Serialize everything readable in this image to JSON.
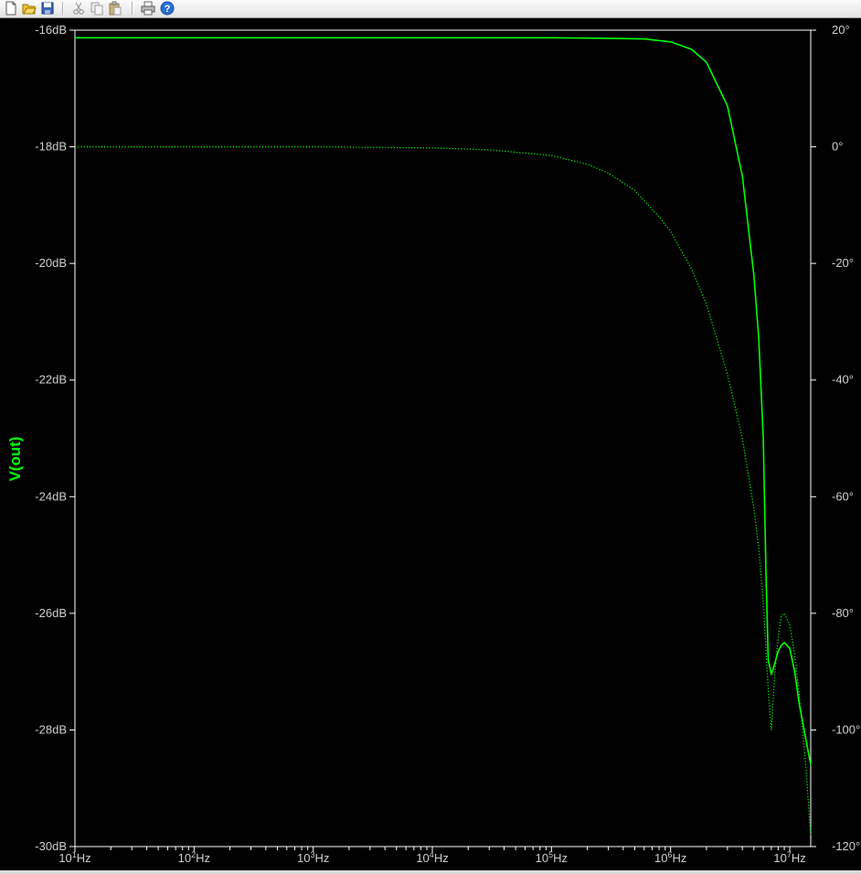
{
  "toolbar": {
    "buttons": [
      {
        "name": "new-icon"
      },
      {
        "name": "open-folder-icon"
      },
      {
        "name": "save-icon"
      },
      {
        "name": "cut-icon"
      },
      {
        "name": "copy-icon"
      },
      {
        "name": "paste-icon"
      },
      {
        "name": "print-icon"
      },
      {
        "name": "help-icon"
      }
    ]
  },
  "colors": {
    "background": "#000000",
    "trace": "#00ff00",
    "axis": "#ffffff",
    "tick_text": "#d0d0d0",
    "grid": "#404040"
  },
  "chart_data": {
    "type": "line",
    "ylabel": "V(out)",
    "x_scale": "log",
    "xlim": [
      10,
      15000000
    ],
    "ylim": [
      -30,
      -16
    ],
    "y2lim": [
      -120,
      20
    ],
    "x_ticks": [
      {
        "value": 10,
        "base": "10",
        "exp": "1",
        "unit": "Hz"
      },
      {
        "value": 100,
        "base": "10",
        "exp": "2",
        "unit": "Hz"
      },
      {
        "value": 1000,
        "base": "10",
        "exp": "3",
        "unit": "Hz"
      },
      {
        "value": 10000,
        "base": "10",
        "exp": "4",
        "unit": "Hz"
      },
      {
        "value": 100000,
        "base": "10",
        "exp": "5",
        "unit": "Hz"
      },
      {
        "value": 1000000,
        "base": "10",
        "exp": "6",
        "unit": "Hz"
      },
      {
        "value": 10000000,
        "base": "10",
        "exp": "7",
        "unit": "Hz"
      }
    ],
    "y_ticks": [
      {
        "value": -16,
        "label": "-16dB"
      },
      {
        "value": -18,
        "label": "-18dB"
      },
      {
        "value": -20,
        "label": "-20dB"
      },
      {
        "value": -22,
        "label": "-22dB"
      },
      {
        "value": -24,
        "label": "-24dB"
      },
      {
        "value": -26,
        "label": "-26dB"
      },
      {
        "value": -28,
        "label": "-28dB"
      },
      {
        "value": -30,
        "label": "-30dB"
      }
    ],
    "y2_ticks": [
      {
        "value": 20,
        "label": "20°"
      },
      {
        "value": 0,
        "label": "0°"
      },
      {
        "value": -20,
        "label": "-20°"
      },
      {
        "value": -40,
        "label": "-40°"
      },
      {
        "value": -60,
        "label": "-60°"
      },
      {
        "value": -80,
        "label": "-80°"
      },
      {
        "value": -100,
        "label": "-100°"
      },
      {
        "value": -120,
        "label": "-120°"
      }
    ],
    "series": [
      {
        "axis": "left",
        "style": "solid",
        "x": [
          10,
          100,
          1000,
          10000,
          100000,
          300000,
          600000,
          1000000,
          1500000,
          2000000,
          3000000,
          4000000,
          5000000,
          5500000,
          6000000,
          6300000,
          6600000,
          7000000,
          7500000,
          8000000,
          8500000,
          9000000,
          10000000,
          11000000,
          12000000,
          13500000,
          15000000
        ],
        "y": [
          -16.13,
          -16.13,
          -16.13,
          -16.13,
          -16.13,
          -16.14,
          -16.15,
          -16.2,
          -16.33,
          -16.55,
          -17.3,
          -18.5,
          -20.2,
          -21.3,
          -23.0,
          -25.2,
          -26.8,
          -27.05,
          -26.85,
          -26.65,
          -26.55,
          -26.5,
          -26.6,
          -27.0,
          -27.55,
          -28.1,
          -28.6
        ]
      },
      {
        "axis": "right",
        "style": "dotted",
        "x": [
          10,
          100,
          1000,
          10000,
          30000,
          100000,
          200000,
          300000,
          500000,
          800000,
          1000000,
          1500000,
          2000000,
          3000000,
          4000000,
          5000000,
          5500000,
          6000000,
          6300000,
          6600000,
          7000000,
          7500000,
          8000000,
          8500000,
          9000000,
          10000000,
          11000000,
          12000000,
          13500000,
          15000000
        ],
        "y": [
          0,
          0,
          0,
          -0.2,
          -0.5,
          -1.5,
          -3,
          -4.5,
          -7.5,
          -12,
          -14.5,
          -21,
          -27,
          -39,
          -50,
          -62,
          -69,
          -78,
          -86,
          -93,
          -100,
          -90,
          -84,
          -80.5,
          -80,
          -82,
          -87,
          -94,
          -105,
          -118
        ]
      }
    ]
  }
}
